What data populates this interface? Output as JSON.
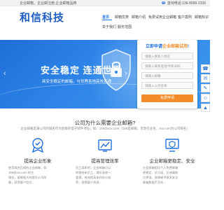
{
  "topbar": {
    "tagline": "企业邮箱，企业邮注册,企业邮箱品牌",
    "contact": "咨询电话:136-8098-2336"
  },
  "header": {
    "logo_text": "和信科技",
    "nav_row1": [
      "首页",
      "邮箱优势",
      "邮箱介绍",
      "免费试用企业邮箱",
      "客户案例",
      "邮箱知识"
    ],
    "nav_row2": [
      "关于我们",
      "服务范围"
    ]
  },
  "banner": {
    "headline": "安全稳定  连通世界",
    "subline": "商安全稳定的邮箱，与世界各地高效连通",
    "arrow_left": "‹",
    "arrow_right": "›",
    "dot_count": 3,
    "active_dot": 1
  },
  "login": {
    "title_prefix": "立即申请",
    "title_accent": "企业邮箱试用",
    "title_suffix": "!",
    "fields": [
      {
        "placeholder": "请输入联系人姓名"
      },
      {
        "placeholder": "请输入联系电话/手机号码"
      },
      {
        "placeholder": "请输入邮箱"
      },
      {
        "placeholder": "请输入公司名称"
      }
    ],
    "submit_label": "免费申请"
  },
  "side_tools": [
    "phone-icon",
    "chat-icon",
    "mail-icon",
    "qq-icon",
    "top-icon"
  ],
  "why": {
    "title": "公司为什么需要企业邮箱?",
    "desc": "企业邮箱是满公司的域名作为后缀的电子邮件地址，如：168@xxx.com（168是邮箱，可改在业务，xxx.com为公司域名）"
  },
  "features": [
    {
      "title": "提高企业形象",
      "lines": [
        "使用域名后缀的企业邮箱，如",
        "168@xxx.com 的主",
        "域名，能够极大的提升公司形",
        "象，获得客户信任..."
      ]
    },
    {
      "title": "提高管理效率",
      "lines": [
        "员工离职时，企业邮箱可以",
        "转移给新员工，通讯录统一",
        "管理，有效提高协同办公效",
        "率，保障客户资源..."
      ]
    },
    {
      "title": "企业邮箱更稳定、安全",
      "lines": [
        "企业邮箱相比个人免费邮箱",
        "更稳定，反垃圾、反病毒能",
        "力更强，保障邮件收发安全",
        "邮箱数据不丢失..."
      ]
    }
  ],
  "colors": {
    "brand_blue": "#1f6fe0",
    "accent_orange": "#f28c28",
    "banner_blue": "#2f86e8"
  }
}
